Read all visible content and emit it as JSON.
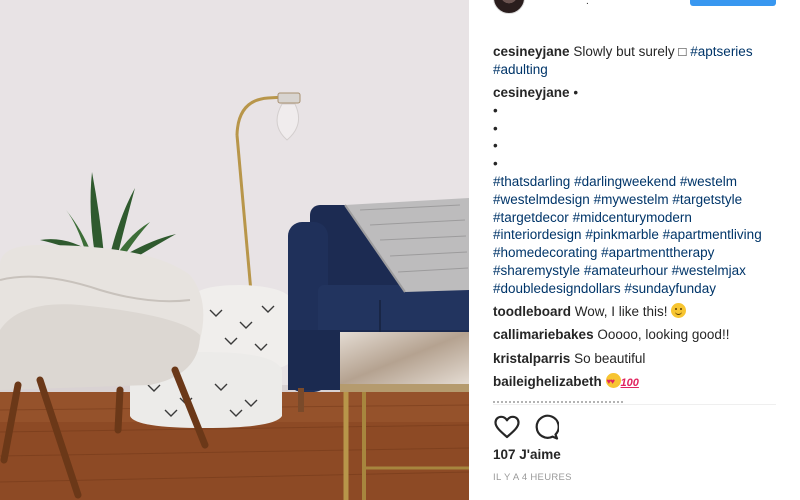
{
  "post": {
    "photo_alt": "",
    "header": {
      "username_fragment": "."
    }
  },
  "comments": [
    {
      "user": "cesineyjane",
      "text": "Slowly but surely □ ",
      "hashtags": [
        "#aptseries",
        "#adulting"
      ]
    },
    {
      "user": "cesineyjane",
      "text": "•",
      "bullets": [
        "•",
        "•",
        "•",
        "•"
      ],
      "hashtags": [
        "#thatsdarling",
        "#darlingweekend",
        "#westelm",
        "#westelmdesign",
        "#mywestelm",
        "#targetstyle",
        "#targetdecor",
        "#midcenturymodern",
        "#interiordesign",
        "#pinkmarble",
        "#apartmentliving",
        "#homedecorating",
        "#apartmenttherapy",
        "#sharemystyle",
        "#amateurhour",
        "#westelmjax",
        "#doubledesigndollars",
        "#sundayfunday"
      ]
    },
    {
      "user": "toodleboard",
      "text": "Wow, I like this!",
      "emoji": "smiling-face"
    },
    {
      "user": "callimariebakes",
      "text": "Ooooo, looking good!!"
    },
    {
      "user": "kristalparris",
      "text": "So beautiful"
    },
    {
      "user": "baileighelizabeth",
      "text": "",
      "emoji": "heart-eyes-100",
      "emoji_100": "100"
    }
  ],
  "actions": {
    "like_icon": "heart-outline-icon",
    "comment_icon": "speech-bubble-icon"
  },
  "likes_label": "107 J'aime",
  "timestamp": "IL Y A 4 HEURES",
  "colors": {
    "link": "#003569",
    "follow_button": "#3897f0",
    "text": "#262626",
    "muted": "#999999"
  }
}
